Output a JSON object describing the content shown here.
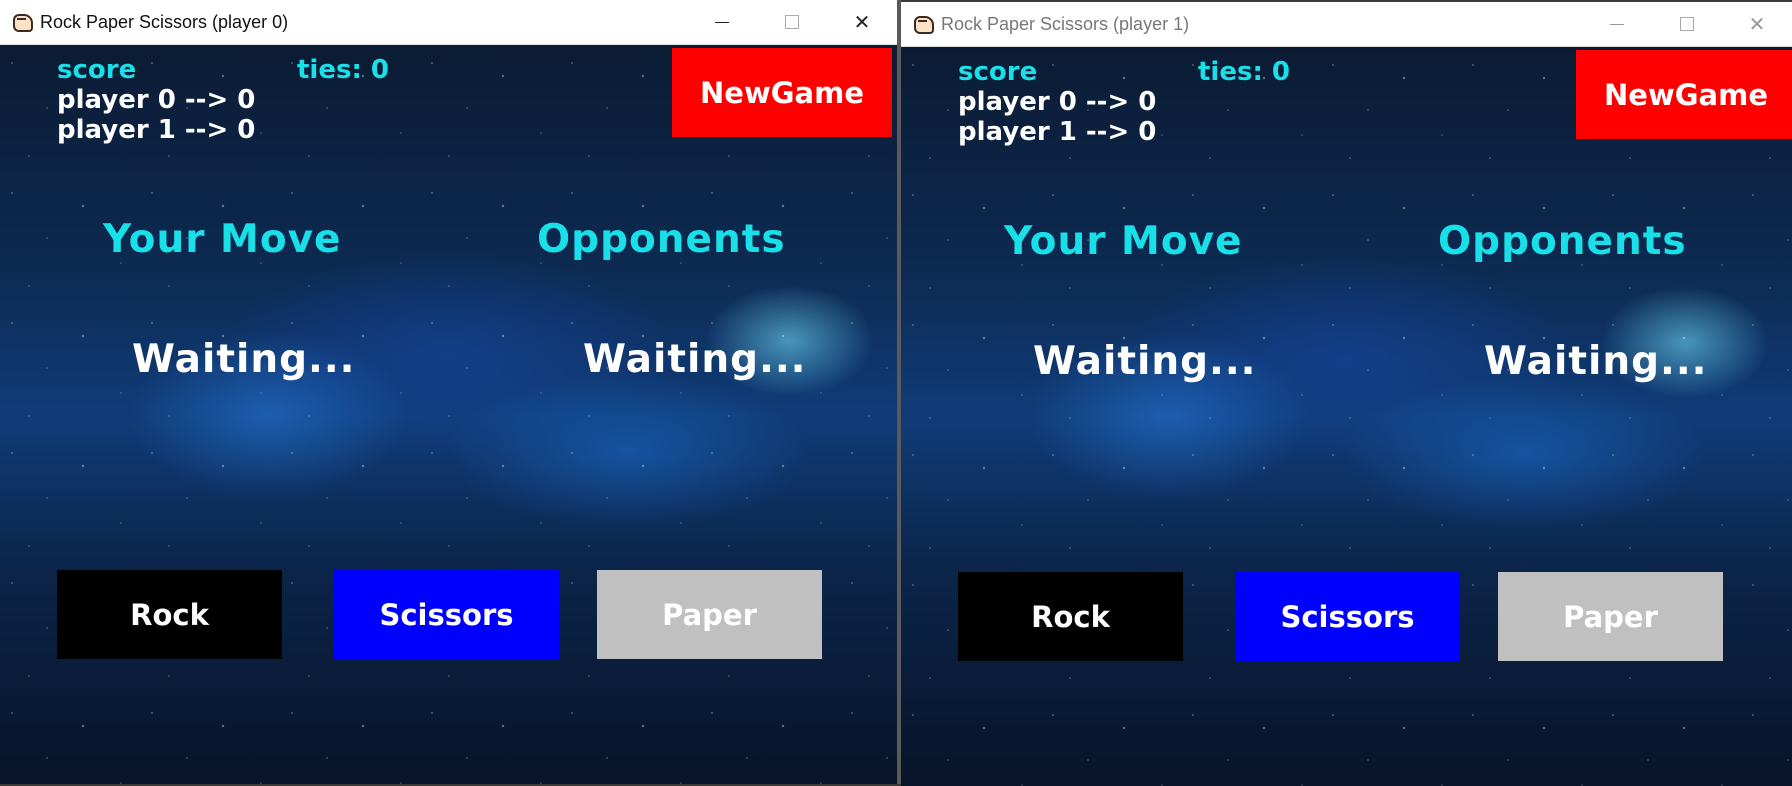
{
  "windows": [
    {
      "title": "Rock Paper Scissors (player 0)",
      "score_label": "score",
      "ties_label": "ties: 0",
      "player0_score": "player 0 --> 0",
      "player1_score": "player 1 --> 0",
      "newgame_label": "NewGame",
      "your_move_label": "Your Move",
      "opponents_label": "Opponents",
      "your_status": "Waiting...",
      "opponent_status": "Waiting...",
      "buttons": {
        "rock": "Rock",
        "scissors": "Scissors",
        "paper": "Paper"
      },
      "controls": {
        "minimize": "—",
        "maximize": "☐",
        "close": "✕"
      }
    },
    {
      "title": "Rock Paper Scissors (player 1)",
      "score_label": "score",
      "ties_label": "ties: 0",
      "player0_score": "player 0 --> 0",
      "player1_score": "player 1 --> 0",
      "newgame_label": "NewGame",
      "your_move_label": "Your Move",
      "opponents_label": "Opponents",
      "your_status": "Waiting...",
      "opponent_status": "Waiting...",
      "buttons": {
        "rock": "Rock",
        "scissors": "Scissors",
        "paper": "Paper"
      },
      "controls": {
        "minimize": "—",
        "maximize": "☐",
        "close": "✕"
      }
    }
  ],
  "colors": {
    "accent_cyan": "#19e0e8",
    "newgame_red": "#ff0000",
    "rock_black": "#000000",
    "scissors_blue": "#0000ff",
    "paper_gray": "#c0c0c0"
  }
}
